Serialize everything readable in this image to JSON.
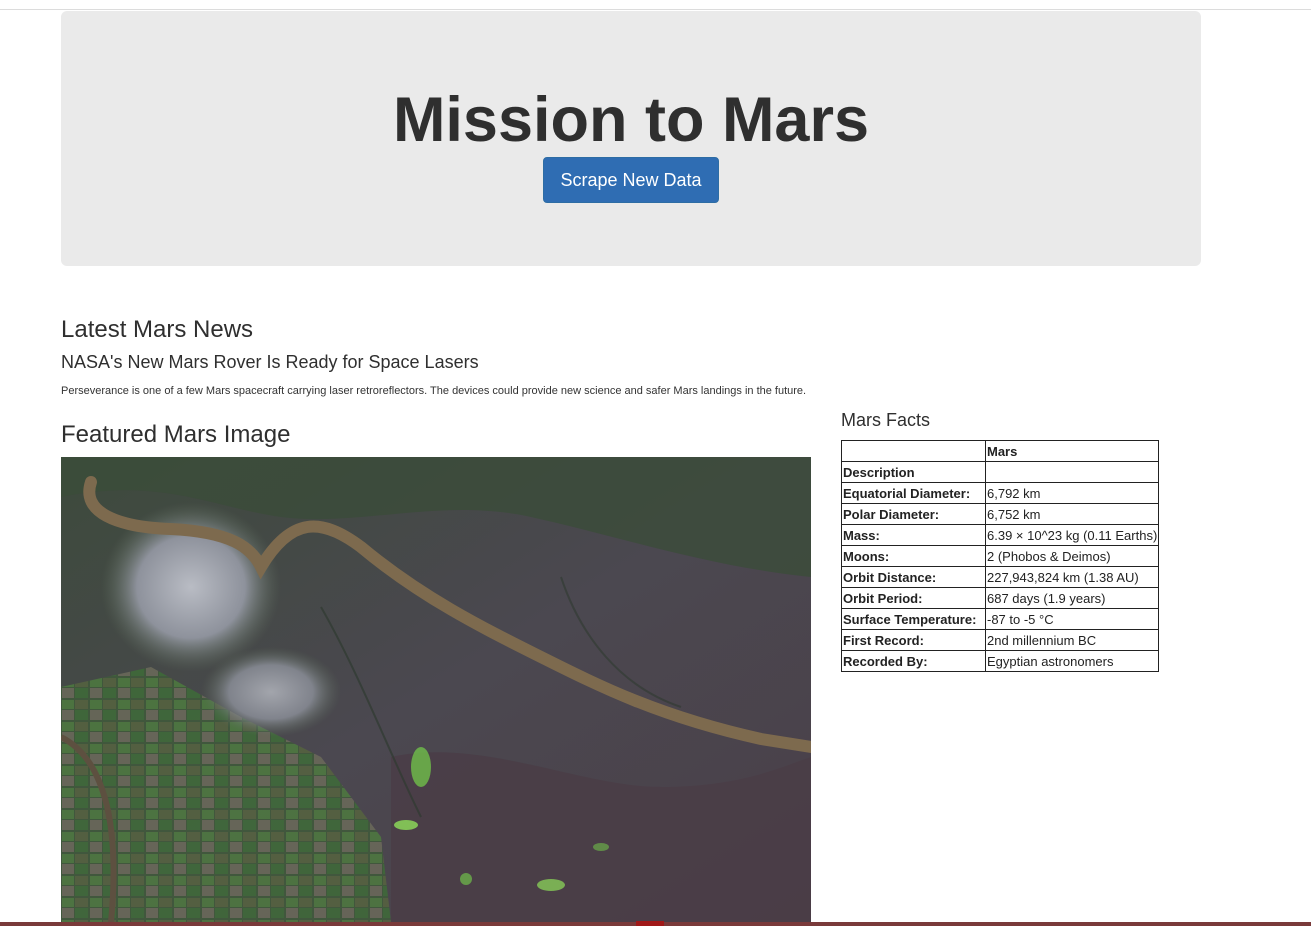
{
  "jumbotron": {
    "title": "Mission to Mars",
    "button_label": "Scrape New Data"
  },
  "news": {
    "heading": "Latest Mars News",
    "title": "NASA's New Mars Rover Is Ready for Space Lasers",
    "paragraph": "Perseverance is one of a few Mars spacecraft carrying laser retroreflectors. The devices could provide new science and safer Mars landings in the future."
  },
  "featured": {
    "heading": "Featured Mars Image"
  },
  "facts": {
    "heading": "Mars Facts",
    "column_header": "Mars",
    "index_label": "Description",
    "rows": [
      {
        "label": "Equatorial Diameter:",
        "value": "6,792 km"
      },
      {
        "label": "Polar Diameter:",
        "value": "6,752 km"
      },
      {
        "label": "Mass:",
        "value": "6.39 × 10^23 kg (0.11 Earths)"
      },
      {
        "label": "Moons:",
        "value": "2 (Phobos & Deimos)"
      },
      {
        "label": "Orbit Distance:",
        "value": "227,943,824 km (1.38 AU)"
      },
      {
        "label": "Orbit Period:",
        "value": "687 days (1.9 years)"
      },
      {
        "label": "Surface Temperature:",
        "value": "-87 to -5 °C"
      },
      {
        "label": "First Record:",
        "value": "2nd millennium BC"
      },
      {
        "label": "Recorded By:",
        "value": "Egyptian astronomers"
      }
    ]
  },
  "colors": {
    "button": "#2f6db3",
    "jumbotron_bg": "#eaeaea",
    "river": "#7d6a4e"
  }
}
